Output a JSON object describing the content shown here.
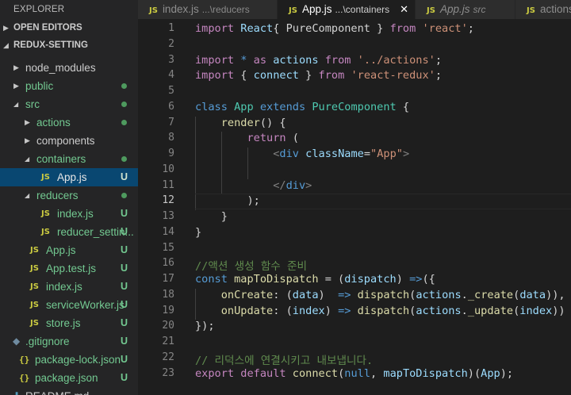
{
  "sidebar": {
    "title": "EXPLORER",
    "sections": [
      {
        "label": "OPEN EDITORS",
        "expanded": false
      },
      {
        "label": "REDUX-SETTING",
        "expanded": true
      }
    ],
    "tree": [
      {
        "label": "node_modules",
        "kind": "folder",
        "expanded": false,
        "indent": 0,
        "status": ""
      },
      {
        "label": "public",
        "kind": "folder",
        "expanded": false,
        "indent": 0,
        "status": "dot"
      },
      {
        "label": "src",
        "kind": "folder",
        "expanded": true,
        "indent": 0,
        "status": "dot"
      },
      {
        "label": "actions",
        "kind": "folder",
        "expanded": false,
        "indent": 1,
        "status": "dot"
      },
      {
        "label": "components",
        "kind": "folder",
        "expanded": false,
        "indent": 1,
        "status": ""
      },
      {
        "label": "containers",
        "kind": "folder",
        "expanded": true,
        "indent": 1,
        "status": "dot"
      },
      {
        "label": "App.js",
        "kind": "js",
        "indent": 2,
        "status": "U",
        "selected": true
      },
      {
        "label": "reducers",
        "kind": "folder",
        "expanded": true,
        "indent": 1,
        "status": "dot"
      },
      {
        "label": "index.js",
        "kind": "js",
        "indent": 2,
        "status": "U"
      },
      {
        "label": "reducer_settin...",
        "kind": "js",
        "indent": 2,
        "status": "U"
      },
      {
        "label": "App.js",
        "kind": "js",
        "indent": 1,
        "status": "U"
      },
      {
        "label": "App.test.js",
        "kind": "js",
        "indent": 1,
        "status": "U"
      },
      {
        "label": "index.js",
        "kind": "js",
        "indent": 1,
        "status": "U"
      },
      {
        "label": "serviceWorker.js",
        "kind": "js",
        "indent": 1,
        "status": "U"
      },
      {
        "label": "store.js",
        "kind": "js",
        "indent": 1,
        "status": "U"
      },
      {
        "label": ".gitignore",
        "kind": "git",
        "indent": 0,
        "status": "U"
      },
      {
        "label": "package-lock.json",
        "kind": "json",
        "indent": 0,
        "status": "U"
      },
      {
        "label": "package.json",
        "kind": "json",
        "indent": 0,
        "status": "U"
      },
      {
        "label": "README.md",
        "kind": "md",
        "indent": 0,
        "status": ""
      }
    ]
  },
  "tabs": [
    {
      "icon": "JS",
      "name": "index.js",
      "desc": "...\\reducers",
      "active": false,
      "italic": false
    },
    {
      "icon": "JS",
      "name": "App.js",
      "desc": "...\\containers",
      "active": true,
      "italic": false,
      "close": "✕"
    },
    {
      "icon": "JS",
      "name": "App.js",
      "desc": "src",
      "active": false,
      "italic": true
    },
    {
      "icon": "JS",
      "name": "actions",
      "desc": "",
      "active": false,
      "italic": false
    }
  ],
  "editor": {
    "current_line": 12,
    "lines": [
      [
        [
          "imp",
          "import "
        ],
        [
          "var",
          "React"
        ],
        [
          "",
          "{ "
        ],
        [
          "",
          "PureComponent"
        ],
        [
          "",
          " } "
        ],
        [
          "imp",
          "from "
        ],
        [
          "str",
          "'react'"
        ],
        [
          "",
          ";"
        ]
      ],
      [],
      [
        [
          "imp",
          "import "
        ],
        [
          "kw",
          "* "
        ],
        [
          "imp",
          "as "
        ],
        [
          "var",
          "actions "
        ],
        [
          "imp",
          "from "
        ],
        [
          "str",
          "'../actions'"
        ],
        [
          "",
          ";"
        ]
      ],
      [
        [
          "imp",
          "import "
        ],
        [
          "",
          "{ "
        ],
        [
          "var",
          "connect"
        ],
        [
          "",
          " } "
        ],
        [
          "imp",
          "from "
        ],
        [
          "str",
          "'react-redux'"
        ],
        [
          "",
          ";"
        ]
      ],
      [],
      [
        [
          "kw",
          "class "
        ],
        [
          "typ",
          "App "
        ],
        [
          "kw",
          "extends "
        ],
        [
          "typ",
          "PureComponent "
        ],
        [
          "",
          "{"
        ]
      ],
      [
        [
          "",
          "    "
        ],
        [
          "fn",
          "render"
        ],
        [
          "",
          "() {"
        ]
      ],
      [
        [
          "",
          "        "
        ],
        [
          "imp",
          "return "
        ],
        [
          "",
          "("
        ]
      ],
      [
        [
          "",
          "            "
        ],
        [
          "punc",
          "<"
        ],
        [
          "tag",
          "div "
        ],
        [
          "attr",
          "className"
        ],
        [
          "",
          "="
        ],
        [
          "str",
          "\"App\""
        ],
        [
          "punc",
          ">"
        ]
      ],
      [],
      [
        [
          "",
          "            "
        ],
        [
          "punc",
          "</"
        ],
        [
          "tag",
          "div"
        ],
        [
          "punc",
          ">"
        ]
      ],
      [
        [
          "",
          "        );"
        ]
      ],
      [
        [
          "",
          "    }"
        ]
      ],
      [
        [
          "",
          "}"
        ]
      ],
      [],
      [
        [
          "cmt",
          "//액션 생성 함수 준비"
        ]
      ],
      [
        [
          "kw",
          "const "
        ],
        [
          "fn",
          "mapToDispatch "
        ],
        [
          "",
          "= ("
        ],
        [
          "var",
          "dispatch"
        ],
        [
          "",
          ") "
        ],
        [
          "kw",
          "=>"
        ],
        [
          "",
          "({"
        ]
      ],
      [
        [
          "",
          "    "
        ],
        [
          "fn",
          "onCreate"
        ],
        [
          "",
          ": ("
        ],
        [
          "var",
          "data"
        ],
        [
          "",
          ")  "
        ],
        [
          "kw",
          "=> "
        ],
        [
          "fn",
          "dispatch"
        ],
        [
          "",
          "("
        ],
        [
          "var",
          "actions"
        ],
        [
          "",
          "."
        ],
        [
          "fn",
          "_create"
        ],
        [
          "",
          "("
        ],
        [
          "var",
          "data"
        ],
        [
          "",
          ")),"
        ]
      ],
      [
        [
          "",
          "    "
        ],
        [
          "fn",
          "onUpdate"
        ],
        [
          "",
          ": ("
        ],
        [
          "var",
          "index"
        ],
        [
          "",
          ") "
        ],
        [
          "kw",
          "=> "
        ],
        [
          "fn",
          "dispatch"
        ],
        [
          "",
          "("
        ],
        [
          "var",
          "actions"
        ],
        [
          "",
          "."
        ],
        [
          "fn",
          "_update"
        ],
        [
          "",
          "("
        ],
        [
          "var",
          "index"
        ],
        [
          "",
          "))"
        ]
      ],
      [
        [
          "",
          "});"
        ]
      ],
      [],
      [
        [
          "cmt",
          "// 리덕스에 연결시키고 내보냅니다."
        ]
      ],
      [
        [
          "imp",
          "export "
        ],
        [
          "imp",
          "default "
        ],
        [
          "fn",
          "connect"
        ],
        [
          "",
          "("
        ],
        [
          "kw",
          "null"
        ],
        [
          "",
          ", "
        ],
        [
          "var",
          "mapToDispatch"
        ],
        [
          "",
          ")("
        ],
        [
          "var",
          "App"
        ],
        [
          "",
          ");"
        ]
      ]
    ]
  }
}
